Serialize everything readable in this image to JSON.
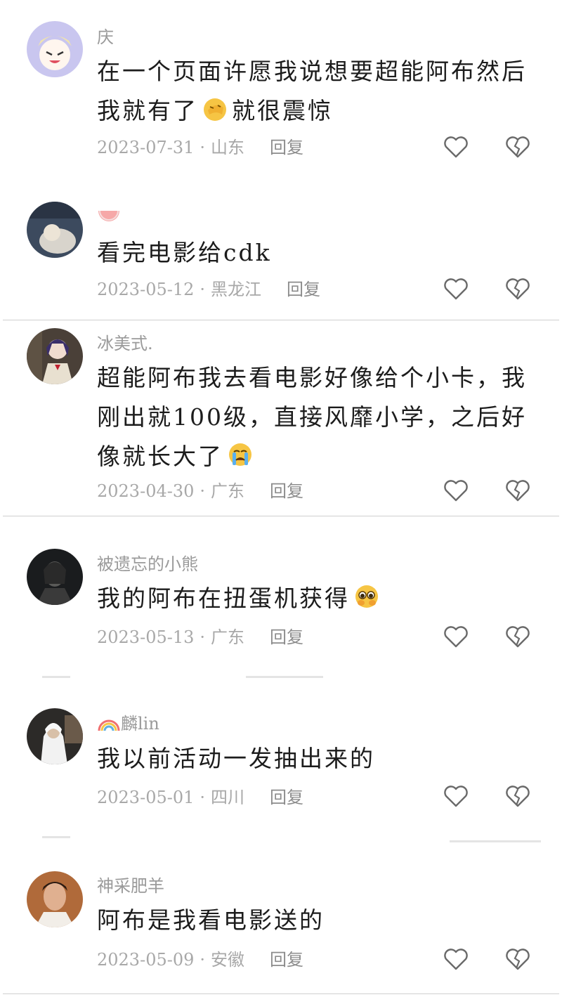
{
  "comments": [
    {
      "username": "庆",
      "text_before": "在一个页面许愿我说想要超能阿布然后我就有了",
      "emoji": "facepalm-emoji",
      "text_after": "就很震惊",
      "date": "2023-07-31",
      "sep": "·",
      "location": "山东",
      "reply": "回复"
    },
    {
      "username_icon": "watermelon-icon",
      "text_before": "看完电影给cdk",
      "date": "2023-05-12",
      "sep": "·",
      "location": "黑龙江",
      "reply": "回复"
    },
    {
      "username": "冰美式.",
      "text_before": "超能阿布我去看电影好像给个小卡，我刚出就100级，直接风靡小学，之后好像就长大了",
      "emoji": "crying-emoji",
      "date": "2023-04-30",
      "sep": "·",
      "location": "广东",
      "reply": "回复"
    },
    {
      "username": "被遗忘的小熊",
      "text_before": "我的阿布在扭蛋机获得",
      "emoji": "pleading-emoji",
      "date": "2023-05-13",
      "sep": "·",
      "location": "广东",
      "reply": "回复"
    },
    {
      "username_icon": "rainbow-icon",
      "username": "麟lin",
      "text_before": "我以前活动一发抽出来的",
      "date": "2023-05-01",
      "sep": "·",
      "location": "四川",
      "reply": "回复"
    },
    {
      "username": "神采肥羊",
      "text_before": "阿布是我看电影送的",
      "date": "2023-05-09",
      "sep": "·",
      "location": "安徽",
      "reply": "回复"
    }
  ],
  "colors": {
    "text": "#1c1c1c",
    "muted": "#a8a8a8",
    "icon": "#6a6a6a"
  }
}
